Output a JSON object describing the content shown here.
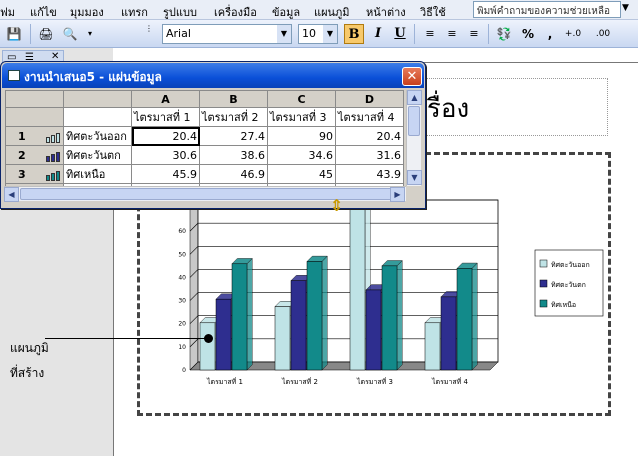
{
  "menu": {
    "items": [
      "ฟม",
      "แก้ไข",
      "มุมมอง",
      "แทรก",
      "รูปแบบ",
      "เครื่องมือ",
      "ข้อมูล",
      "แผนภูมิ",
      "หน้าต่าง",
      "วิธีใช้"
    ],
    "help_placeholder": "พิมพ์คำถามของความช่วยเหลือ"
  },
  "toolbar": {
    "font_name": "Arial",
    "font_size": "10",
    "bold": "B",
    "italic": "I",
    "underline": "U",
    "percent": "%",
    "comma": ",",
    "inc_decimal": "+.0",
    "dec_decimal": ".00"
  },
  "datasheet": {
    "title": "งานนำเสนอ5 - แผ่นข้อมูล",
    "columns": [
      "A",
      "B",
      "C",
      "D"
    ],
    "header_row": [
      "ไตรมาสที่ 1",
      "ไตรมาสที่ 2",
      "ไตรมาสที่ 3",
      "ไตรมาสที่ 4"
    ],
    "rows": [
      {
        "num": "1",
        "label": "ทิศตะวันออก",
        "values": [
          "20.4",
          "27.4",
          "90",
          "20.4"
        ]
      },
      {
        "num": "2",
        "label": "ทิศตะวันตก",
        "values": [
          "30.6",
          "38.6",
          "34.6",
          "31.6"
        ]
      },
      {
        "num": "3",
        "label": "ทิศเหนือ",
        "values": [
          "45.9",
          "46.9",
          "45",
          "43.9"
        ]
      },
      {
        "num": "4",
        "label": "",
        "values": [
          "",
          "",
          "",
          ""
        ]
      }
    ]
  },
  "slide": {
    "title_fragment": "เรื่อง"
  },
  "callout": {
    "line1": "แผนภูมิ",
    "line2": "ที่สร้าง"
  },
  "colors": {
    "east": "#bfe3e6",
    "west": "#2e2e8f",
    "north": "#128a8a"
  },
  "chart_data": {
    "type": "bar",
    "categories": [
      "ไตรมาสที่ 1",
      "ไตรมาสที่ 2",
      "ไตรมาสที่ 3",
      "ไตรมาสที่ 4"
    ],
    "series": [
      {
        "name": "ทิศตะวันออก",
        "values": [
          20.4,
          27.4,
          90,
          20.4
        ]
      },
      {
        "name": "ทิศตะวันตก",
        "values": [
          30.6,
          38.6,
          34.6,
          31.6
        ]
      },
      {
        "name": "ทิศเหนือ",
        "values": [
          45.9,
          46.9,
          45,
          43.9
        ]
      }
    ],
    "ylim": [
      0,
      70
    ],
    "yticks": [
      "0",
      "10",
      "20",
      "30",
      "40",
      "50",
      "60",
      "70"
    ],
    "legend_position": "right",
    "grid": true,
    "style": "3d-clustered-column"
  }
}
